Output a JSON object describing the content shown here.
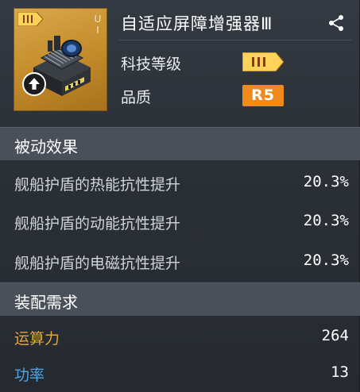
{
  "item": {
    "name": "自适应屏障增强器Ⅲ",
    "thumbnail_marks": "U I"
  },
  "info": {
    "tech_level_label": "科技等级",
    "quality_label": "品质",
    "quality_value": "R5"
  },
  "passive": {
    "title": "被动效果",
    "effects": [
      {
        "label": "舰船护盾的热能抗性提升",
        "value": "20.3%"
      },
      {
        "label": "舰船护盾的动能抗性提升",
        "value": "20.3%"
      },
      {
        "label": "舰船护盾的电磁抗性提升",
        "value": "20.3%"
      }
    ]
  },
  "requirements": {
    "title": "装配需求",
    "items": [
      {
        "label": "运算力",
        "value": "264",
        "color": "#e0a63a"
      },
      {
        "label": "功率",
        "value": "13",
        "color": "#4aa8e8"
      }
    ]
  },
  "colors": {
    "accent_orange": "#f08a1a",
    "thumb_gold": "#d9a84a",
    "section_bg": "#4a5059"
  },
  "icons": {
    "tier": "tier-III-chevron-icon",
    "share": "share-icon",
    "upgrade": "up-arrow-icon"
  }
}
